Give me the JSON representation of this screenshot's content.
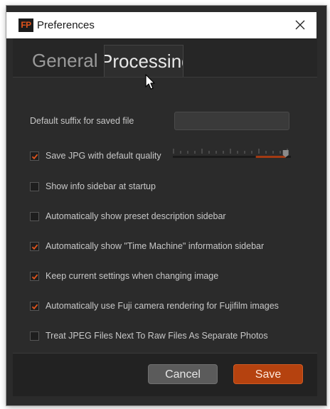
{
  "window": {
    "title": "Preferences",
    "app_icon_text": "FP"
  },
  "tabs": [
    {
      "label": "General",
      "active": false
    },
    {
      "label": "Processing",
      "active": true
    }
  ],
  "suffix": {
    "label": "Default suffix for saved file",
    "value": ""
  },
  "options": [
    {
      "label": "Save JPG with default quality",
      "checked": true
    },
    {
      "label": "Show info sidebar at startup",
      "checked": false
    },
    {
      "label": "Automatically show preset description sidebar",
      "checked": false
    },
    {
      "label": "Automatically show \"Time Machine\" information sidebar",
      "checked": true
    },
    {
      "label": "Keep current settings when changing image",
      "checked": true
    },
    {
      "label": "Automatically use Fuji camera rendering for Fujifilm images",
      "checked": true
    },
    {
      "label": "Treat JPEG Files Next To Raw Files As Separate Photos",
      "checked": false
    }
  ],
  "quality_slider": {
    "value_fraction": 0.98
  },
  "buttons": {
    "cancel": "Cancel",
    "save": "Save"
  },
  "colors": {
    "accent": "#b5420f",
    "check": "#e2541b",
    "background": "#2b2b2b"
  }
}
